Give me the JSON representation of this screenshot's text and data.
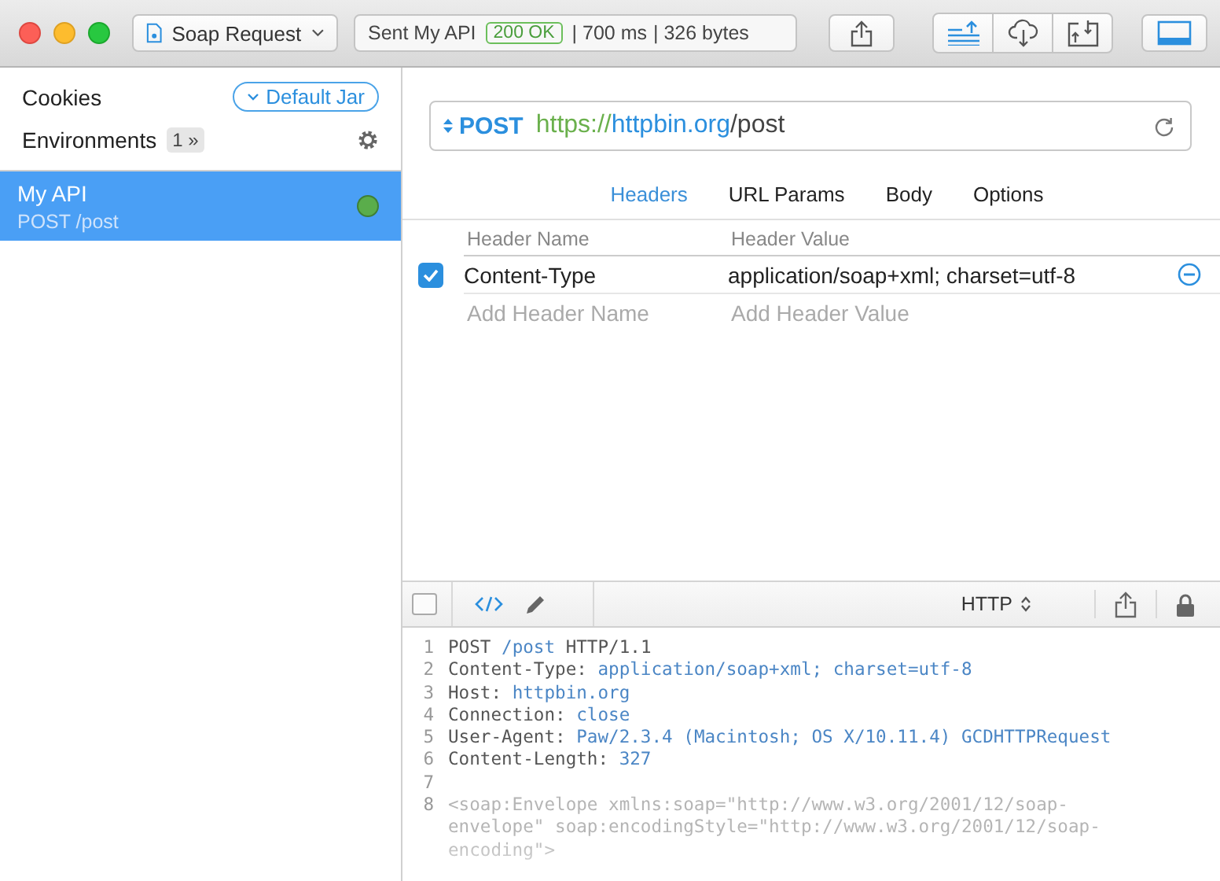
{
  "toolbar": {
    "request_menu": "Soap Request",
    "status": {
      "text": "Sent My API",
      "code": "200 OK",
      "time": "| 700 ms",
      "size": "| 326 bytes"
    }
  },
  "sidebar": {
    "cookies": {
      "label": "Cookies",
      "jar": "Default Jar"
    },
    "environments": {
      "label": "Environments",
      "count": "1 »"
    },
    "requests": [
      {
        "name": "My API",
        "subtitle": "POST /post",
        "selected": true
      }
    ]
  },
  "request": {
    "method": "POST",
    "url": [
      {
        "kind": "scheme",
        "text": "https://"
      },
      {
        "kind": "host",
        "text": "httpbin.org"
      },
      {
        "kind": "path",
        "text": "/post"
      }
    ]
  },
  "tabs": [
    {
      "label": "Headers",
      "selected": true
    },
    {
      "label": "URL Params",
      "selected": false
    },
    {
      "label": "Body",
      "selected": false
    },
    {
      "label": "Options",
      "selected": false
    }
  ],
  "headers": {
    "columns": [
      "Header Name",
      "Header Value"
    ],
    "rows": [
      {
        "name": "Content-Type",
        "value": "application/soap+xml; charset=utf-8",
        "enabled": true
      }
    ],
    "new_row": {
      "name_placeholder": "Add Header Name",
      "value_placeholder": "Add Header Value"
    }
  },
  "response": {
    "format": "HTTP",
    "lines": [
      {
        "number": "1",
        "parts": [
          {
            "kind": "key",
            "text": "POST "
          },
          {
            "kind": "value",
            "text": "/post"
          },
          {
            "kind": "key",
            "text": " HTTP/1.1"
          }
        ]
      },
      {
        "number": "2",
        "parts": [
          {
            "kind": "key",
            "text": "Content-Type: "
          },
          {
            "kind": "value",
            "text": "application/soap+xml; charset=utf-8"
          }
        ]
      },
      {
        "number": "3",
        "parts": [
          {
            "kind": "key",
            "text": "Host: "
          },
          {
            "kind": "value",
            "text": "httpbin.org"
          }
        ]
      },
      {
        "number": "4",
        "parts": [
          {
            "kind": "key",
            "text": "Connection: "
          },
          {
            "kind": "value",
            "text": "close"
          }
        ]
      },
      {
        "number": "5",
        "parts": [
          {
            "kind": "key",
            "text": "User-Agent: "
          },
          {
            "kind": "value",
            "text": "Paw/2.3.4 (Macintosh; OS X/10.11.4) GCDHTTPRequest"
          }
        ]
      },
      {
        "number": "6",
        "parts": [
          {
            "kind": "key",
            "text": "Content-Length: "
          },
          {
            "kind": "value",
            "text": "327"
          }
        ]
      },
      {
        "number": "7"
      },
      {
        "number": "8",
        "parts": [
          {
            "kind": "body",
            "text": "<soap:Envelope xmlns:soap=\"http://www.w3.org/2001/12/soap-envelope\" soap:encodingStyle=\"http://www.w3.org/2001/12/soap-encoding\">"
          }
        ]
      }
    ]
  }
}
